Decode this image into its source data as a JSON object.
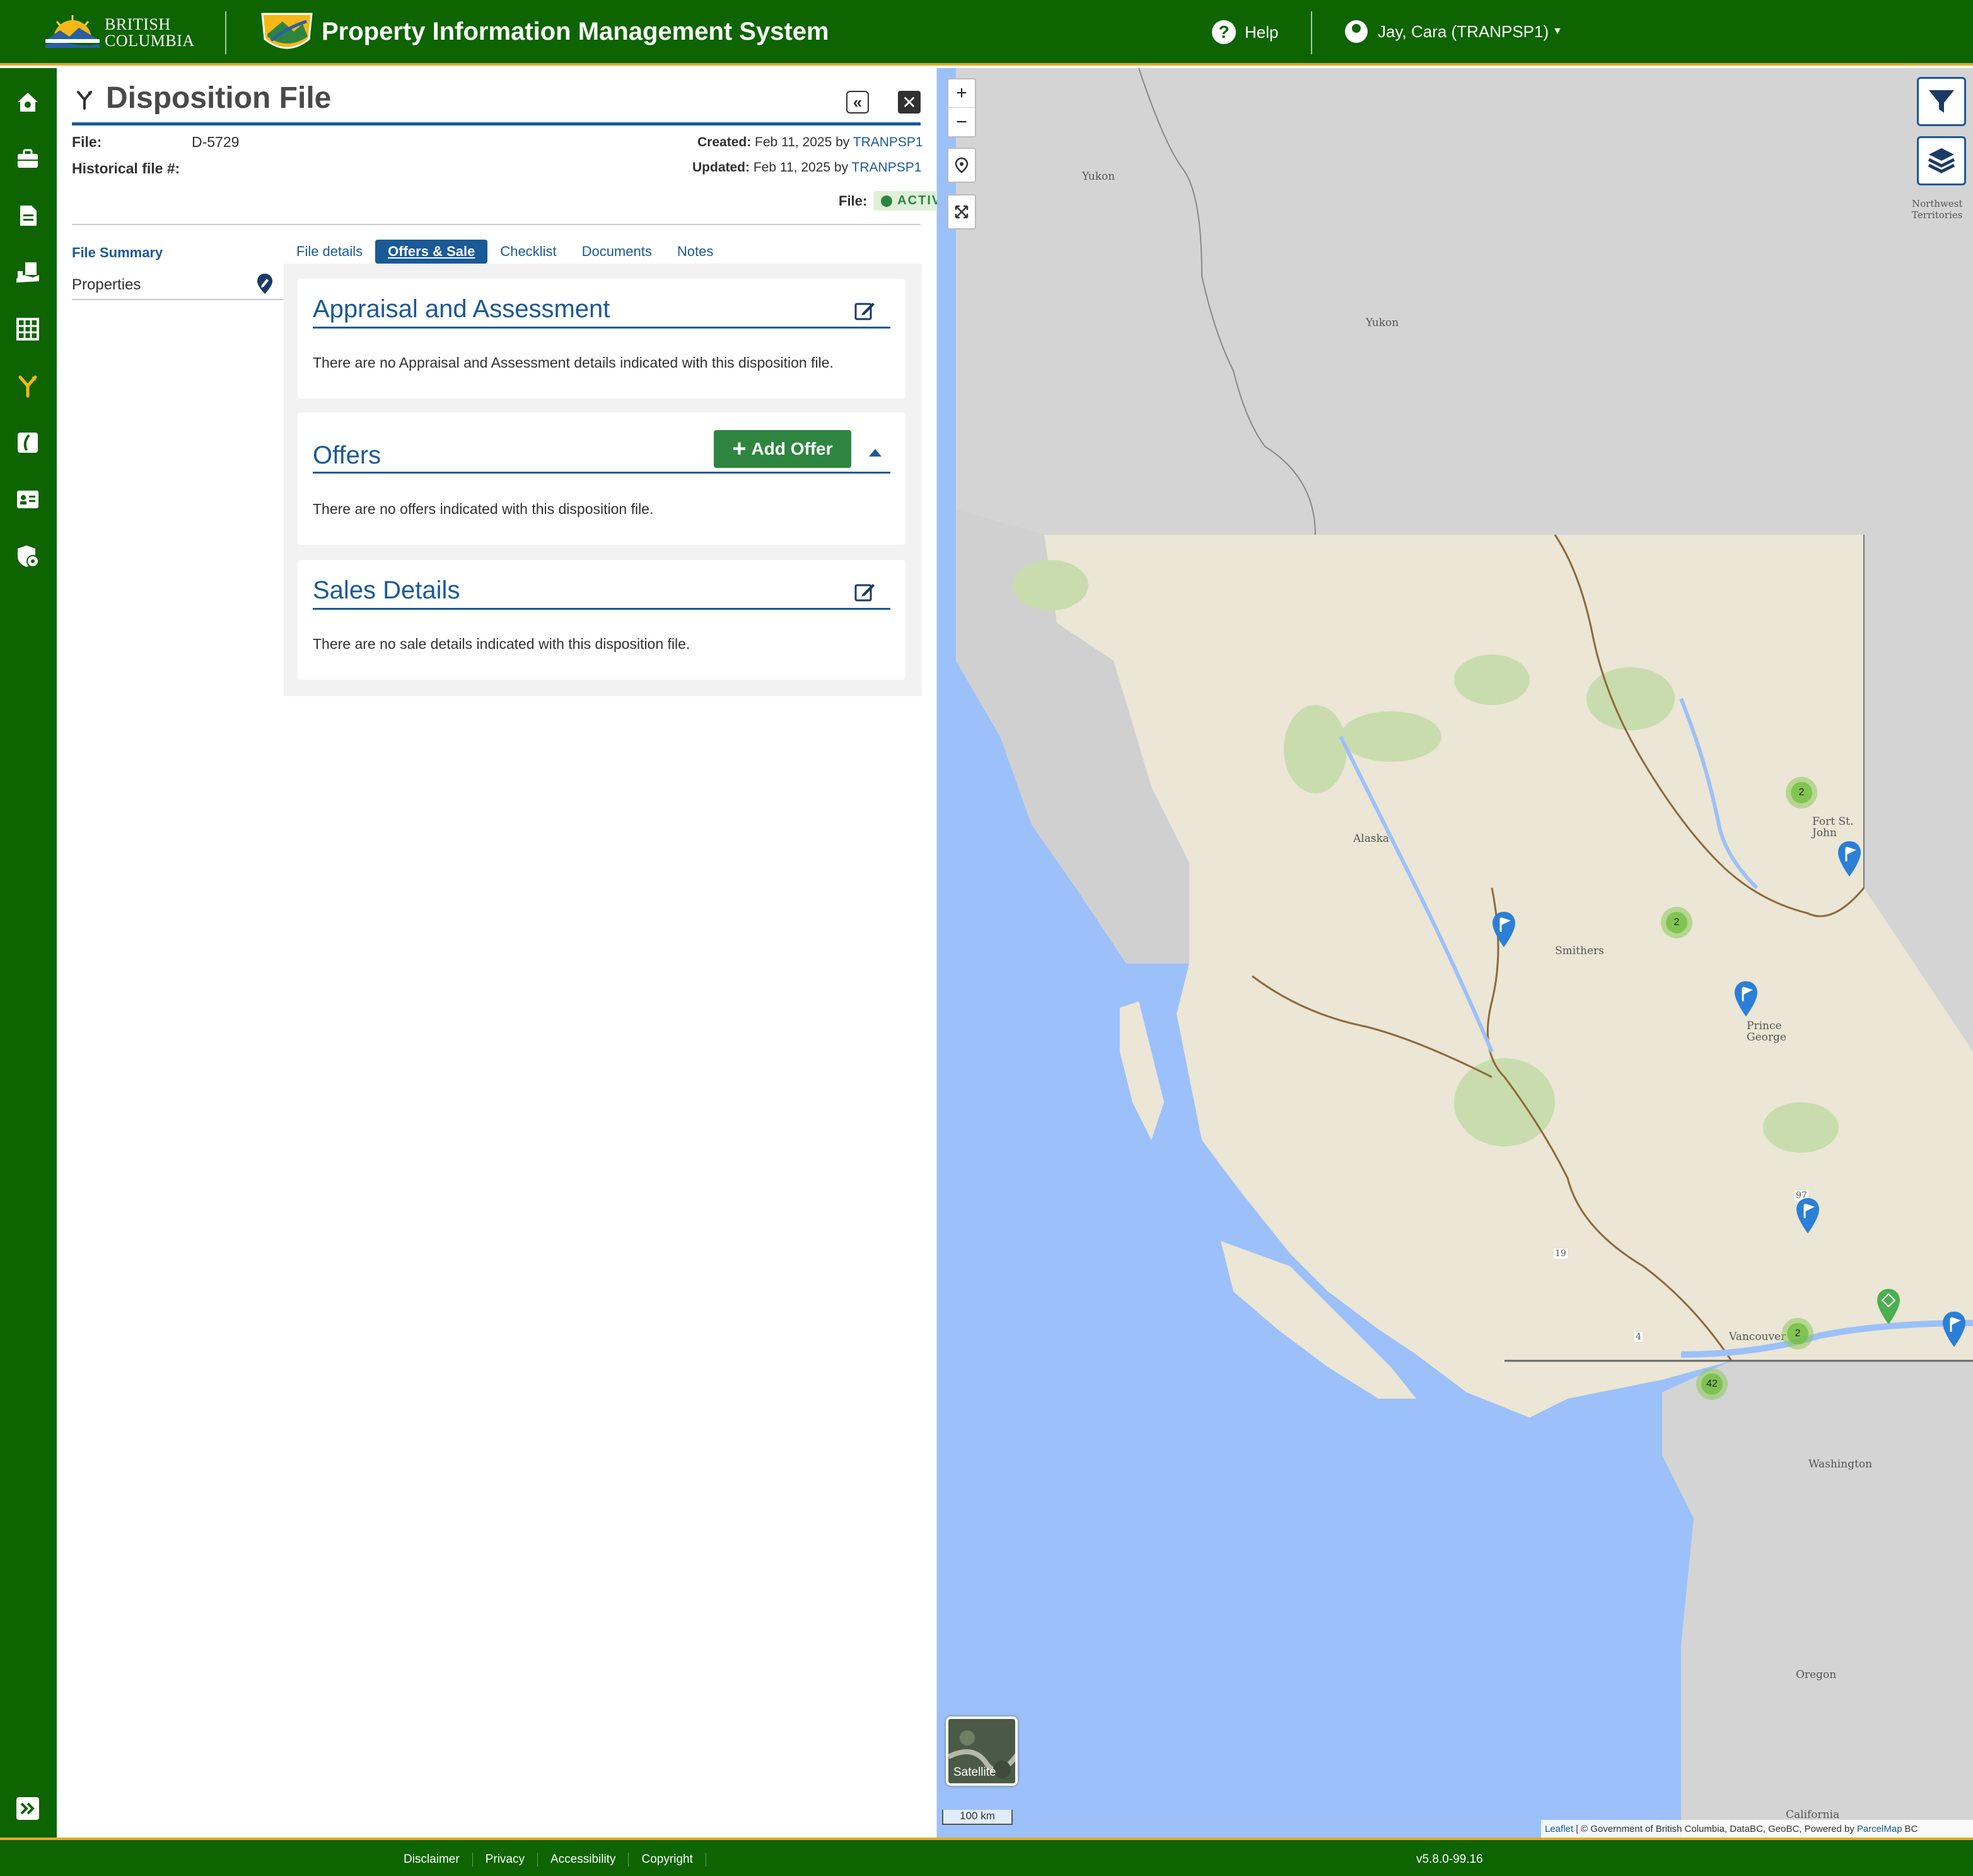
{
  "header": {
    "brand_line1": "British",
    "brand_line2": "Columbia",
    "app_title": "Property Information Management System",
    "help_label": "Help",
    "user_label": "Jay, Cara (TRANPSP1)"
  },
  "nav_icons": [
    "home-icon",
    "briefcase-icon",
    "file-icon",
    "hand-holding-icon",
    "grid-icon",
    "disposition-icon",
    "road-icon",
    "contact-card-icon",
    "admin-shield-icon"
  ],
  "panel": {
    "title": "Disposition File",
    "file_label": "File:",
    "file_number": "D-5729",
    "historical_label": "Historical file #:",
    "created_label": "Created:",
    "created_date": "Feb 11, 2025 by",
    "created_by": "TRANPSP1",
    "updated_label": "Updated:",
    "updated_date": "Feb 11, 2025 by",
    "updated_by": "TRANPSP1",
    "status_label": "File:",
    "status_value": "ACTIVE",
    "file_summary": "File Summary",
    "properties": "Properties"
  },
  "tabs": [
    "File details",
    "Offers & Sale",
    "Checklist",
    "Documents",
    "Notes"
  ],
  "active_tab": "Offers & Sale",
  "sections": {
    "appraisal": {
      "title": "Appraisal and Assessment",
      "empty": "There are no Appraisal and Assessment details indicated with this disposition file."
    },
    "offers": {
      "title": "Offers",
      "add_button": "Add Offer",
      "empty": "There are no offers indicated with this disposition file."
    },
    "sales": {
      "title": "Sales Details",
      "empty": "There are no sale details indicated with this disposition file."
    }
  },
  "map": {
    "zoom_in": "+",
    "zoom_out": "−",
    "satellite_label": "Satellite",
    "scale_label": "100 km",
    "attribution_leaflet": "Leaflet",
    "attribution_text": "| © Government of British Columbia, DataBC, GeoBC, Powered by",
    "attribution_parcelmap": "ParcelMap",
    "attribution_end": "BC",
    "labels": {
      "yukon1": "Yukon",
      "yukon2": "Yukon",
      "nwt1": "Northwest",
      "nwt2": "Territories",
      "alaska": "Alaska",
      "smithers": "Smithers",
      "prince_george1": "Prince",
      "prince_george2": "George",
      "fort_st_john1": "Fort St.",
      "fort_st_john2": "John",
      "vancouver": "Vancouver",
      "washington": "Washington",
      "oregon": "Oregon",
      "california": "California",
      "hwy97": "97",
      "hwy19": "19",
      "hwy4": "4"
    },
    "clusters": [
      "2",
      "2",
      "2",
      "42"
    ]
  },
  "footer": {
    "links": [
      "Disclaimer",
      "Privacy",
      "Accessibility",
      "Copyright"
    ],
    "version": "v5.8.0-99.16"
  }
}
